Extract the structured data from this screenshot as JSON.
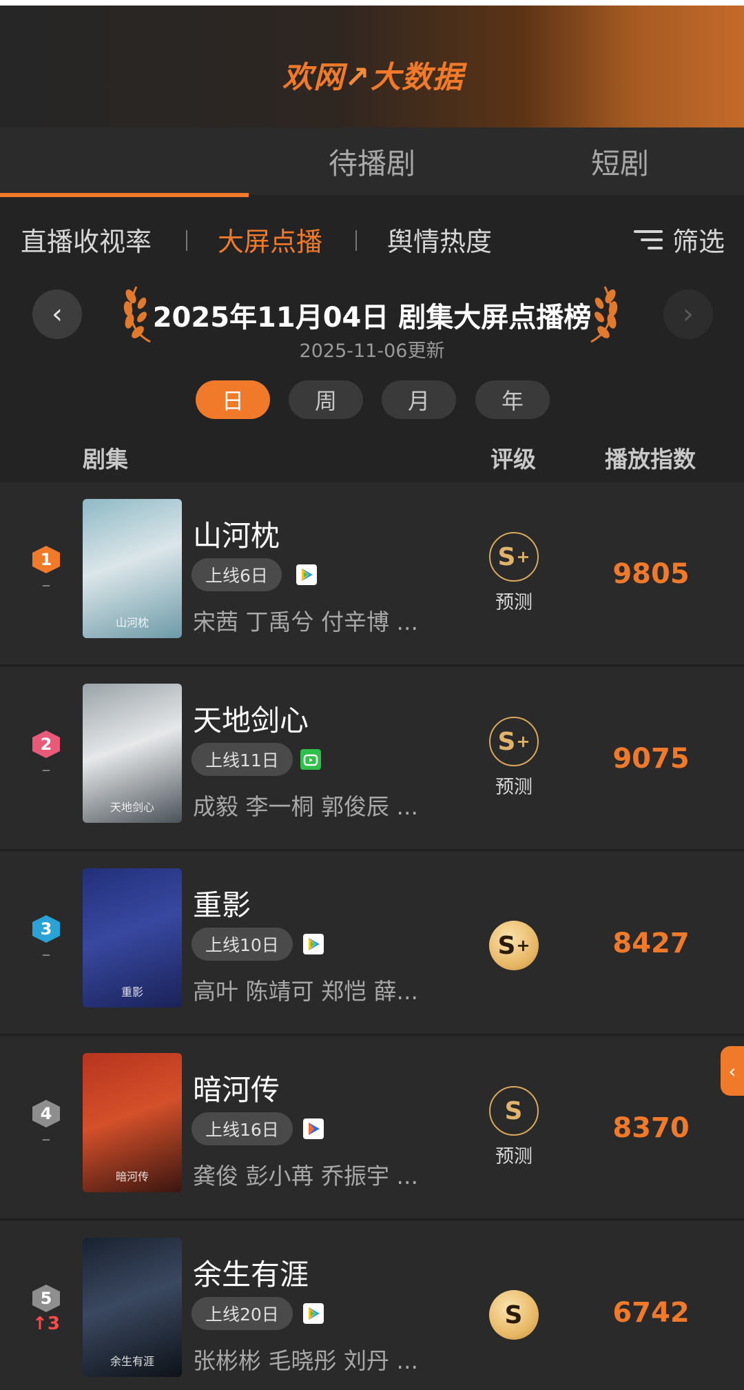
{
  "app": {
    "logo_text": "欢网",
    "logo_mark": "↗",
    "logo_text2": "大数据"
  },
  "tabs": [
    {
      "label": "",
      "active": true
    },
    {
      "label": "待播剧",
      "active": false
    },
    {
      "label": "短剧",
      "active": false
    }
  ],
  "subnav": {
    "items": [
      "直播收视率",
      "大屏点播",
      "舆情热度"
    ],
    "active": "大屏点播",
    "filter_label": "筛选"
  },
  "board": {
    "title": "2025年11月04日 剧集大屏点播榜",
    "updated": "2025-11-06更新",
    "prev_icon": "‹",
    "next_icon": "›"
  },
  "periods": [
    "日",
    "周",
    "月",
    "年"
  ],
  "columns": {
    "series": "剧集",
    "grade": "评级",
    "index": "播放指数"
  },
  "accent_color": "#f07a2a",
  "rows": [
    {
      "rank": "1",
      "rank_color": "#f07a2a",
      "change": "–",
      "title": "山河枕",
      "days": "上线6日",
      "platform": "tencent-video-icon",
      "cast": "宋茜 丁禹兮 付辛博 ...",
      "grade": "S",
      "grade_plus": "+",
      "grade_style": "outline",
      "predict": "预测",
      "score": "9805"
    },
    {
      "rank": "2",
      "rank_color": "#e85a78",
      "change": "–",
      "title": "天地剑心",
      "days": "上线11日",
      "platform": "iqiyi-icon",
      "cast": "成毅 李一桐 郭俊辰 ...",
      "grade": "S",
      "grade_plus": "+",
      "grade_style": "outline",
      "predict": "预测",
      "score": "9075"
    },
    {
      "rank": "3",
      "rank_color": "#29a3d6",
      "change": "–",
      "title": "重影",
      "days": "上线10日",
      "platform": "tencent-video-icon",
      "cast": "高叶 陈靖可 郑恺 薛...",
      "grade": "S",
      "grade_plus": "+",
      "grade_style": "filled",
      "predict": "",
      "score": "8427"
    },
    {
      "rank": "4",
      "rank_color": "#8e8e8e",
      "change": "–",
      "title": "暗河传",
      "days": "上线16日",
      "platform": "youku-icon",
      "cast": "龚俊 彭小苒 乔振宇 ...",
      "grade": "S",
      "grade_plus": "",
      "grade_style": "outline",
      "predict": "预测",
      "score": "8370"
    },
    {
      "rank": "5",
      "rank_color": "#8e8e8e",
      "change": "↑3",
      "title": "余生有涯",
      "days": "上线20日",
      "platform": "tencent-video-icon",
      "cast": "张彬彬 毛晓彤 刘丹 ...",
      "grade": "S",
      "grade_plus": "",
      "grade_style": "filled",
      "predict": "",
      "score": "6742"
    }
  ]
}
